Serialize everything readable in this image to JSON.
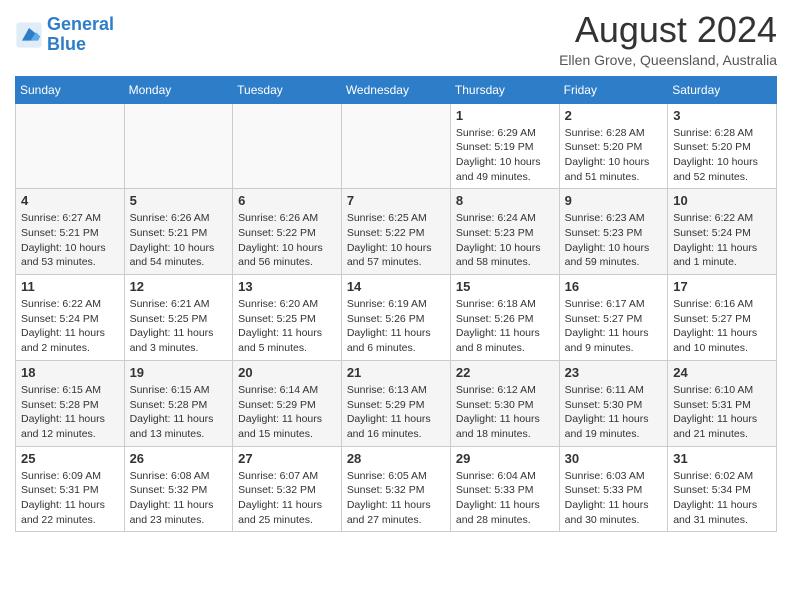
{
  "logo": {
    "line1": "General",
    "line2": "Blue"
  },
  "title": "August 2024",
  "location": "Ellen Grove, Queensland, Australia",
  "days_of_week": [
    "Sunday",
    "Monday",
    "Tuesday",
    "Wednesday",
    "Thursday",
    "Friday",
    "Saturday"
  ],
  "weeks": [
    [
      {
        "day": "",
        "info": ""
      },
      {
        "day": "",
        "info": ""
      },
      {
        "day": "",
        "info": ""
      },
      {
        "day": "",
        "info": ""
      },
      {
        "day": "1",
        "info": "Sunrise: 6:29 AM\nSunset: 5:19 PM\nDaylight: 10 hours and 49 minutes."
      },
      {
        "day": "2",
        "info": "Sunrise: 6:28 AM\nSunset: 5:20 PM\nDaylight: 10 hours and 51 minutes."
      },
      {
        "day": "3",
        "info": "Sunrise: 6:28 AM\nSunset: 5:20 PM\nDaylight: 10 hours and 52 minutes."
      }
    ],
    [
      {
        "day": "4",
        "info": "Sunrise: 6:27 AM\nSunset: 5:21 PM\nDaylight: 10 hours and 53 minutes."
      },
      {
        "day": "5",
        "info": "Sunrise: 6:26 AM\nSunset: 5:21 PM\nDaylight: 10 hours and 54 minutes."
      },
      {
        "day": "6",
        "info": "Sunrise: 6:26 AM\nSunset: 5:22 PM\nDaylight: 10 hours and 56 minutes."
      },
      {
        "day": "7",
        "info": "Sunrise: 6:25 AM\nSunset: 5:22 PM\nDaylight: 10 hours and 57 minutes."
      },
      {
        "day": "8",
        "info": "Sunrise: 6:24 AM\nSunset: 5:23 PM\nDaylight: 10 hours and 58 minutes."
      },
      {
        "day": "9",
        "info": "Sunrise: 6:23 AM\nSunset: 5:23 PM\nDaylight: 10 hours and 59 minutes."
      },
      {
        "day": "10",
        "info": "Sunrise: 6:22 AM\nSunset: 5:24 PM\nDaylight: 11 hours and 1 minute."
      }
    ],
    [
      {
        "day": "11",
        "info": "Sunrise: 6:22 AM\nSunset: 5:24 PM\nDaylight: 11 hours and 2 minutes."
      },
      {
        "day": "12",
        "info": "Sunrise: 6:21 AM\nSunset: 5:25 PM\nDaylight: 11 hours and 3 minutes."
      },
      {
        "day": "13",
        "info": "Sunrise: 6:20 AM\nSunset: 5:25 PM\nDaylight: 11 hours and 5 minutes."
      },
      {
        "day": "14",
        "info": "Sunrise: 6:19 AM\nSunset: 5:26 PM\nDaylight: 11 hours and 6 minutes."
      },
      {
        "day": "15",
        "info": "Sunrise: 6:18 AM\nSunset: 5:26 PM\nDaylight: 11 hours and 8 minutes."
      },
      {
        "day": "16",
        "info": "Sunrise: 6:17 AM\nSunset: 5:27 PM\nDaylight: 11 hours and 9 minutes."
      },
      {
        "day": "17",
        "info": "Sunrise: 6:16 AM\nSunset: 5:27 PM\nDaylight: 11 hours and 10 minutes."
      }
    ],
    [
      {
        "day": "18",
        "info": "Sunrise: 6:15 AM\nSunset: 5:28 PM\nDaylight: 11 hours and 12 minutes."
      },
      {
        "day": "19",
        "info": "Sunrise: 6:15 AM\nSunset: 5:28 PM\nDaylight: 11 hours and 13 minutes."
      },
      {
        "day": "20",
        "info": "Sunrise: 6:14 AM\nSunset: 5:29 PM\nDaylight: 11 hours and 15 minutes."
      },
      {
        "day": "21",
        "info": "Sunrise: 6:13 AM\nSunset: 5:29 PM\nDaylight: 11 hours and 16 minutes."
      },
      {
        "day": "22",
        "info": "Sunrise: 6:12 AM\nSunset: 5:30 PM\nDaylight: 11 hours and 18 minutes."
      },
      {
        "day": "23",
        "info": "Sunrise: 6:11 AM\nSunset: 5:30 PM\nDaylight: 11 hours and 19 minutes."
      },
      {
        "day": "24",
        "info": "Sunrise: 6:10 AM\nSunset: 5:31 PM\nDaylight: 11 hours and 21 minutes."
      }
    ],
    [
      {
        "day": "25",
        "info": "Sunrise: 6:09 AM\nSunset: 5:31 PM\nDaylight: 11 hours and 22 minutes."
      },
      {
        "day": "26",
        "info": "Sunrise: 6:08 AM\nSunset: 5:32 PM\nDaylight: 11 hours and 23 minutes."
      },
      {
        "day": "27",
        "info": "Sunrise: 6:07 AM\nSunset: 5:32 PM\nDaylight: 11 hours and 25 minutes."
      },
      {
        "day": "28",
        "info": "Sunrise: 6:05 AM\nSunset: 5:32 PM\nDaylight: 11 hours and 27 minutes."
      },
      {
        "day": "29",
        "info": "Sunrise: 6:04 AM\nSunset: 5:33 PM\nDaylight: 11 hours and 28 minutes."
      },
      {
        "day": "30",
        "info": "Sunrise: 6:03 AM\nSunset: 5:33 PM\nDaylight: 11 hours and 30 minutes."
      },
      {
        "day": "31",
        "info": "Sunrise: 6:02 AM\nSunset: 5:34 PM\nDaylight: 11 hours and 31 minutes."
      }
    ]
  ]
}
